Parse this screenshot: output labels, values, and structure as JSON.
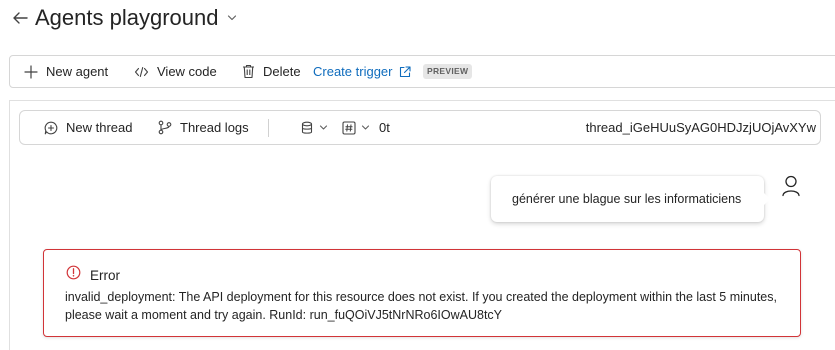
{
  "header": {
    "title": "Agents playground",
    "back_icon": "arrow-left-icon",
    "chevron_icon": "chevron-down-icon"
  },
  "toolbar": {
    "new_agent": "New agent",
    "view_code": "View code",
    "delete": "Delete",
    "create_trigger": "Create trigger",
    "preview_badge": "PREVIEW"
  },
  "thread_bar": {
    "new_thread": "New thread",
    "thread_logs": "Thread logs",
    "token_count": "0t",
    "thread_id": "thread_iGeHUuSyAG0HDJzjUOjAvXYw"
  },
  "chat": {
    "user_message": "générer une blague sur les informaticiens"
  },
  "error": {
    "title": "Error",
    "message": "invalid_deployment: The API deployment for this resource does not exist. If you created the deployment within the last 5 minutes, please wait a moment and try again. RunId: run_fuQOiVJ5tNrNRo6IOwAU8tcY"
  },
  "colors": {
    "link": "#0f6cbd",
    "error_border": "#d13438",
    "text": "#242424"
  }
}
